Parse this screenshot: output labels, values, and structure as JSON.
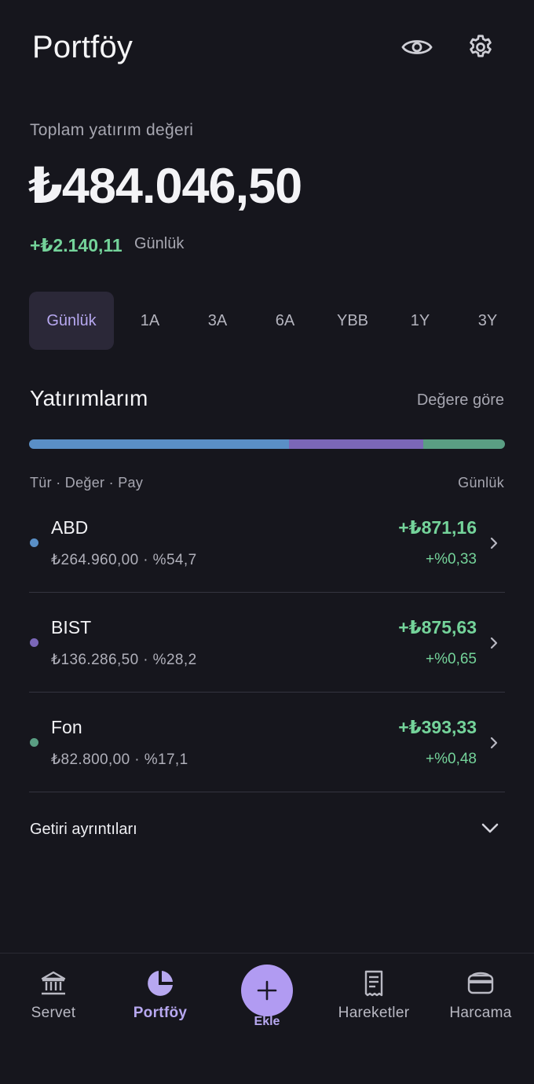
{
  "header": {
    "title": "Portföy"
  },
  "summary": {
    "total_label": "Toplam yatırım değeri",
    "total_value": "₺484.046,50",
    "daily_change": "+₺2.140,11",
    "daily_label": "Günlük"
  },
  "range_tabs": [
    {
      "label": "Günlük",
      "active": true
    },
    {
      "label": "1A"
    },
    {
      "label": "3A"
    },
    {
      "label": "6A"
    },
    {
      "label": "YBB"
    },
    {
      "label": "1Y"
    },
    {
      "label": "3Y"
    }
  ],
  "investments": {
    "title": "Yatırımlarım",
    "sort_label": "Değere göre",
    "column_left": "Tür · Değer · Pay",
    "column_right": "Günlük",
    "items": [
      {
        "name": "ABD",
        "sub": "₺264.960,00 · %54,7",
        "change": "+₺871,16",
        "change_pct": "+%0,33",
        "share": 54.7,
        "color": "#5a8fc6"
      },
      {
        "name": "BIST",
        "sub": "₺136.286,50 · %28,2",
        "change": "+₺875,63",
        "change_pct": "+%0,65",
        "share": 28.2,
        "color": "#7b67b8"
      },
      {
        "name": "Fon",
        "sub": "₺82.800,00 · %17,1",
        "change": "+₺393,33",
        "change_pct": "+%0,48",
        "share": 17.1,
        "color": "#5a9e83"
      }
    ],
    "details_label": "Getiri ayrıntıları"
  },
  "nav": {
    "items": [
      {
        "label": "Servet",
        "icon": "bank-icon"
      },
      {
        "label": "Portföy",
        "icon": "pie-chart-icon",
        "active": true
      },
      {
        "label": "Ekle",
        "icon": "plus-icon"
      },
      {
        "label": "Hareketler",
        "icon": "receipt-icon"
      },
      {
        "label": "Harcama",
        "icon": "wallet-icon"
      }
    ]
  },
  "colors": {
    "accent": "#b19bf2",
    "positive": "#74d39a",
    "background": "#16161d"
  }
}
